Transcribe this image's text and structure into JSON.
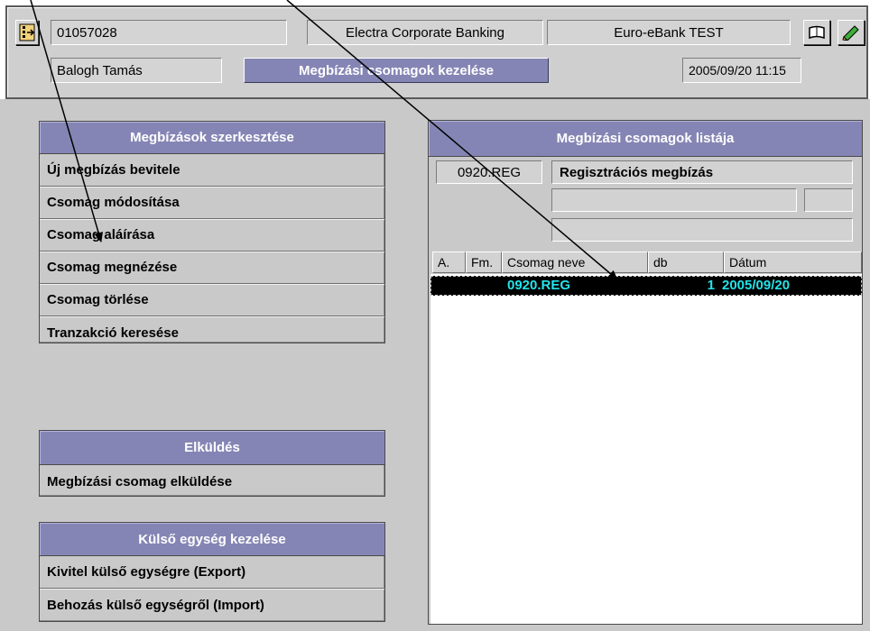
{
  "header": {
    "account": "01057028",
    "app_name": "Electra Corporate Banking",
    "bank_name": "Euro-eBank TEST",
    "user_name": "Balogh Tamás",
    "screen_title": "Megbízási csomagok kezelése",
    "datetime": "2005/09/20 11:15",
    "icons": [
      "exit-icon",
      "book-icon",
      "green-pencil-icon"
    ]
  },
  "left": {
    "edit_panel": {
      "title": "Megbízások szerkesztése",
      "items": [
        "Új megbízás bevitele",
        "Csomag módosítása",
        "Csomag aláírása",
        "Csomag megnézése",
        "Csomag törlése",
        "Tranzakció keresése"
      ]
    },
    "send_panel": {
      "title": "Elküldés",
      "items": [
        "Megbízási csomag elküldése"
      ]
    },
    "external_panel": {
      "title": "Külső egység kezelése",
      "items": [
        "Kivitel külső egységre (Export)",
        "Behozás külső egységről (Import)"
      ]
    }
  },
  "list": {
    "title": "Megbízási csomagok listája",
    "selected_code": "0920.REG",
    "selected_desc": "Regisztrációs megbízás",
    "columns": [
      "A.",
      "Fm.",
      "Csomag neve",
      "db",
      "Dátum"
    ],
    "rows": [
      {
        "a": "",
        "fm": "",
        "name": "0920.REG",
        "db": "1",
        "date": "2005/09/20"
      }
    ]
  },
  "colors": {
    "title_bar": "#8585b5",
    "background": "#c9c9c9",
    "selected_row_bg": "#000000",
    "selected_row_text": "#23e3ea"
  }
}
